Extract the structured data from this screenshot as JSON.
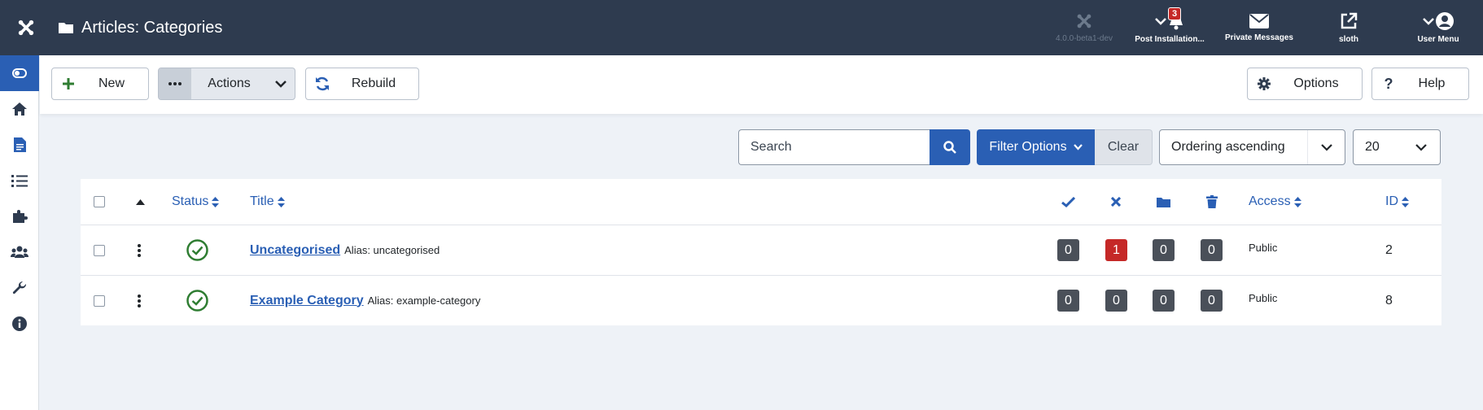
{
  "header": {
    "title": "Articles: Categories",
    "version": "4.0.0-beta1-dev",
    "items": [
      {
        "label": "Post Installation...",
        "icon": "bell-icon",
        "badge": "3"
      },
      {
        "label": "Private Messages",
        "icon": "envelope-icon"
      },
      {
        "label": "sloth",
        "icon": "external-link-icon"
      },
      {
        "label": "User Menu",
        "icon": "user-icon"
      }
    ]
  },
  "sidebar": {
    "items": [
      {
        "icon": "toggle-menu-icon",
        "active": true
      },
      {
        "icon": "home-icon"
      },
      {
        "icon": "file-icon"
      },
      {
        "icon": "list-icon"
      },
      {
        "icon": "puzzle-icon"
      },
      {
        "icon": "users-icon"
      },
      {
        "icon": "wrench-icon"
      },
      {
        "icon": "info-icon"
      }
    ]
  },
  "toolbar": {
    "new_label": "New",
    "actions_label": "Actions",
    "rebuild_label": "Rebuild",
    "options_label": "Options",
    "help_label": "Help"
  },
  "filters": {
    "search_placeholder": "Search",
    "filter_options_label": "Filter Options",
    "clear_label": "Clear",
    "ordering_value": "Ordering ascending",
    "limit_value": "20"
  },
  "table": {
    "headers": {
      "status": "Status",
      "title": "Title",
      "access": "Access",
      "id": "ID"
    },
    "rows": [
      {
        "title": "Uncategorised",
        "alias": "Alias: uncategorised",
        "published": "0",
        "unpublished": "1",
        "archived": "0",
        "trashed": "0",
        "access": "Public",
        "id": "2"
      },
      {
        "title": "Example Category",
        "alias": "Alias: example-category",
        "published": "0",
        "unpublished": "0",
        "archived": "0",
        "trashed": "0",
        "access": "Public",
        "id": "8"
      }
    ]
  },
  "colors": {
    "header_bg": "#2e3b4f",
    "primary": "#2a5fb4",
    "danger": "#c52827",
    "success": "#2f7d32",
    "count_bg": "#4a5059"
  }
}
